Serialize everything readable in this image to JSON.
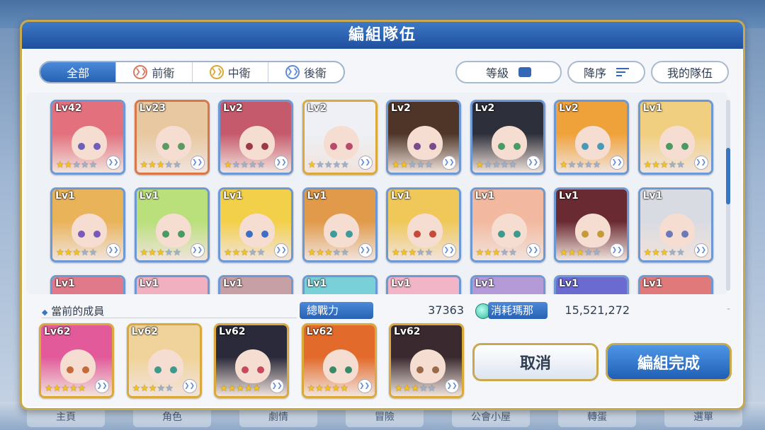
{
  "background": {
    "tabs": [
      "主頁",
      "角色",
      "劇情",
      "冒險",
      "公會小屋",
      "轉蛋",
      "選單"
    ]
  },
  "dialog": {
    "title": "編組隊伍",
    "filters": [
      {
        "label": "全部",
        "icon": ""
      },
      {
        "label": "前衛",
        "icon": "front-position-icon"
      },
      {
        "label": "中衛",
        "icon": "middle-position-icon"
      },
      {
        "label": "後衛",
        "icon": "back-position-icon"
      }
    ],
    "sort": {
      "level_label": "等級",
      "order_label": "降序",
      "my_team_label": "我的隊伍"
    }
  },
  "roster": [
    {
      "level": "Lv42",
      "stars": 2,
      "frame": "blue",
      "hair": "#e2707d",
      "eye": "#6d5fb8"
    },
    {
      "level": "Lv23",
      "stars": 3,
      "frame": "copper",
      "hair": "#e7c8a0",
      "eye": "#5a9a63"
    },
    {
      "level": "Lv2",
      "stars": 1,
      "frame": "blue",
      "hair": "#c65a6d",
      "eye": "#9b3a4a"
    },
    {
      "level": "Lv2",
      "stars": 1,
      "frame": "gold",
      "hair": "#eef0f5",
      "eye": "#b84a6a"
    },
    {
      "level": "Lv2",
      "stars": 2,
      "frame": "blue",
      "hair": "#4e3528",
      "eye": "#7a4a8a"
    },
    {
      "level": "Lv2",
      "stars": 1,
      "frame": "blue",
      "hair": "#2d2f3a",
      "eye": "#4b9a63"
    },
    {
      "level": "Lv2",
      "stars": 1,
      "frame": "blue",
      "hair": "#f0a23a",
      "eye": "#4b9ab5"
    },
    {
      "level": "Lv1",
      "stars": 3,
      "frame": "blue",
      "hair": "#f1cf80",
      "eye": "#4b9a63"
    },
    {
      "level": "Lv1",
      "stars": 3,
      "frame": "blue",
      "hair": "#e9b35a",
      "eye": "#7a5ab8"
    },
    {
      "level": "Lv1",
      "stars": 3,
      "frame": "blue",
      "hair": "#b9e07a",
      "eye": "#4b9a63"
    },
    {
      "level": "Lv1",
      "stars": 3,
      "frame": "blue",
      "hair": "#f3d04a",
      "eye": "#3f6fc5"
    },
    {
      "level": "Lv1",
      "stars": 3,
      "frame": "blue",
      "hair": "#e09a4a",
      "eye": "#3f9a9a"
    },
    {
      "level": "Lv1",
      "stars": 3,
      "frame": "blue",
      "hair": "#f0c85a",
      "eye": "#c54a3a"
    },
    {
      "level": "Lv1",
      "stars": 3,
      "frame": "blue",
      "hair": "#f2b9a0",
      "eye": "#3f9a8a"
    },
    {
      "level": "Lv1",
      "stars": 3,
      "frame": "blue",
      "hair": "#6a2a32",
      "eye": "#c59a3a"
    },
    {
      "level": "Lv1",
      "stars": 3,
      "frame": "blue",
      "hair": "#d9dbe2",
      "eye": "#6a7ab8"
    },
    {
      "level": "Lv1",
      "stars": 0,
      "frame": "blue",
      "hair": "#e07a8a",
      "eye": "#6a7ab8"
    },
    {
      "level": "Lv1",
      "stars": 0,
      "frame": "blue",
      "hair": "#f0b0c0",
      "eye": "#6a7ab8"
    },
    {
      "level": "Lv1",
      "stars": 0,
      "frame": "blue",
      "hair": "#c7a0a5",
      "eye": "#6a7ab8"
    },
    {
      "level": "Lv1",
      "stars": 0,
      "frame": "blue",
      "hair": "#7ad0d8",
      "eye": "#6a7ab8"
    },
    {
      "level": "Lv1",
      "stars": 0,
      "frame": "blue",
      "hair": "#f2b5c8",
      "eye": "#6a7ab8"
    },
    {
      "level": "Lv1",
      "stars": 0,
      "frame": "blue",
      "hair": "#b59ad8",
      "eye": "#6a7ab8"
    },
    {
      "level": "Lv1",
      "stars": 0,
      "frame": "blue",
      "hair": "#6a6ad0",
      "eye": "#6a7ab8"
    },
    {
      "level": "Lv1",
      "stars": 0,
      "frame": "blue",
      "hair": "#e07a7a",
      "eye": "#6a7ab8"
    }
  ],
  "current": {
    "label": "當前的成員",
    "power_label": "總戰力",
    "power_value": "37363",
    "mana_label": "消耗瑪那",
    "mana_value": "15,521,272",
    "mana_dash": "-",
    "members": [
      {
        "level": "Lv62",
        "stars": 5,
        "frame": "gold",
        "hair": "#e25a9a",
        "eye": "#c56a3a"
      },
      {
        "level": "Lv62",
        "stars": 3,
        "frame": "gold",
        "hair": "#f0d39a",
        "eye": "#3f9a8a"
      },
      {
        "level": "Lv62",
        "stars": 5,
        "frame": "gold",
        "hair": "#2a2a3a",
        "eye": "#c54a5a"
      },
      {
        "level": "Lv62",
        "stars": 5,
        "frame": "gold",
        "hair": "#e26a2a",
        "eye": "#3a8a6a"
      },
      {
        "level": "Lv62",
        "stars": 3,
        "frame": "gold",
        "hair": "#3a2a30",
        "eye": "#9a6a4a"
      }
    ]
  },
  "buttons": {
    "cancel": "取消",
    "confirm": "編組完成"
  }
}
